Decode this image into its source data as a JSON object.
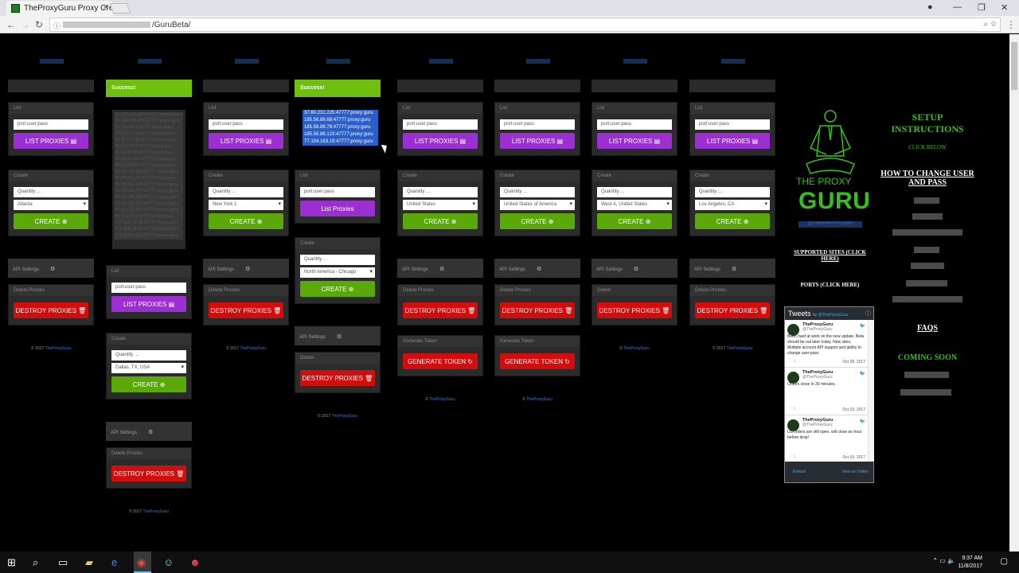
{
  "browser": {
    "tab_title": "TheProxyGuru Proxy Cre",
    "url_visible": "/GuruBeta/",
    "back": "←",
    "forward": "→",
    "reload": "↻"
  },
  "columns": [
    {
      "list_title": "List",
      "list_placeholder": "port:user:pass",
      "list_btn": "LIST PROXIES ▤",
      "create_title": "Create",
      "qty_placeholder": "Quantity ...",
      "region": "Atlanta",
      "create_btn": "CREATE ⊕",
      "api": "API Settings",
      "delete_title": "Delete Proxies",
      "destroy_btn": "DESTROY PROXIES 🗑",
      "footer_year": "© 2017",
      "footer_link": "TheProxyGuru"
    },
    {
      "success": "Success!",
      "proxies": [
        "50.187.134.184:47777:proxy:guru",
        "50.184.209.172:47777:proxy:guru",
        "50.118.58.9:47777:proxy:guru",
        "45.55.111.94:47777:proxy:guru",
        "45.55.71.245:47777:proxy:guru",
        "45.63.6.227:47777:proxy:guru",
        "45.63.85.90:47777:proxy:guru",
        "45.63.79.132:47777:proxy:guru",
        "45.63.90.217:47777:proxy:guru",
        "45.76.103.135:47777:proxy:guru",
        "45.76.151.74:47777:proxy:guru",
        "45.79.151.188:47777:proxy:guru",
        "45.79.156.207:47777:proxy:guru",
        "45.79.155.205:47777:proxy:guru",
        "45.79.156.214:47777:proxy:guru",
        "45.79.179.187:47777:proxy:guru",
        "45.76.100.8:47777:proxy:guru",
        "172.104.10.28:47777:proxy:guru",
        "172.104.14.59:47777:proxy:guru",
        "172.104.3.131:47777:proxy:guru"
      ],
      "list_title": "List",
      "list_placeholder": "port:user:pass",
      "list_btn": "LIST PROXIES ▤",
      "create_title": "Create",
      "qty_placeholder": "Quantity ...",
      "region": "Dallas, TX, USA",
      "create_btn": "CREATE ⊕",
      "api": "API Settings",
      "delete_title": "Delete Proxies",
      "destroy_btn": "DESTROY PROXIES 🗑",
      "footer_year": "© 2017",
      "footer_link": "TheProxyGuru"
    },
    {
      "list_title": "List",
      "list_placeholder": "port:user:pass",
      "list_btn": "LIST PROXIES ▤",
      "create_title": "Create",
      "qty_placeholder": "Quantity ...",
      "region": "New York 1",
      "create_btn": "CREATE ⊕",
      "api": "API Settings",
      "delete_title": "Delete Proxies",
      "destroy_btn": "DESTROY PROXIES 🗑",
      "footer_year": "© 2017",
      "footer_link": "TheProxyGuru"
    },
    {
      "success": "Success!",
      "proxies": [
        "37.60.231.225:47777:proxy:guru",
        "185.56.86.68:47777:proxy:guru",
        "185.56.86.78:47777:proxy:guru",
        "185.56.86.123:47777:proxy:guru",
        "77.104.163.19:47777:proxy:guru"
      ],
      "list_title": "List",
      "list_placeholder": "port:user:pass",
      "list_btn": "List Proxies",
      "create_title": "Create",
      "qty_placeholder": "Quantity ...",
      "region": "North America - Chicago",
      "create_btn": "CREATE ⊕",
      "api": "API Settings",
      "delete_title": "Delete",
      "destroy_btn": "DESTROY PROXIES 🗑",
      "footer_year": "© 2017",
      "footer_link": "TheProxyGuru"
    },
    {
      "list_title": "List",
      "list_placeholder": "port:user:pass",
      "list_btn": "LIST PROXIES ▤",
      "create_title": "Create",
      "qty_placeholder": "Quantity ...",
      "region": "United States",
      "create_btn": "CREATE ⊕",
      "api": "API Settings",
      "delete_title": "Delete Proxies",
      "destroy_btn": "DESTROY PROXIES 🗑",
      "token_title": "Generate Token",
      "token_btn": "GENERATE TOKEN ↻",
      "footer_year": "©",
      "footer_link": "TheProxyGuru"
    },
    {
      "list_title": "List",
      "list_placeholder": "port:user:pass",
      "list_btn": "LIST PROXIES ▤",
      "create_title": "Create",
      "qty_placeholder": "Quantity ...",
      "region": "United States of America",
      "create_btn": "CREATE ⊕",
      "api": "API Settings",
      "delete_title": "Delete Proxies",
      "destroy_btn": "DESTROY PROXIES 🗑",
      "token_title": "Generate Token",
      "token_btn": "GENERATE TOKEN ↻",
      "footer_year": "©",
      "footer_link": "TheProxyGuru"
    },
    {
      "list_title": "List",
      "list_placeholder": "port:user:pass",
      "list_btn": "LIST PROXIES ▤",
      "create_title": "Create",
      "qty_placeholder": "Quantity ...",
      "region": "West A, United States",
      "create_btn": "CREATE ⊕",
      "api": "API Settings",
      "delete_title": "Delete",
      "destroy_btn": "DESTROY PROXIES 🗑",
      "footer_year": "©",
      "footer_link": "TheProxyGuru"
    },
    {
      "list_title": "List",
      "list_placeholder": "port:user:pass",
      "list_btn": "LIST PROXIES ▤",
      "create_title": "Create",
      "qty_placeholder": "Quantity ...",
      "region": "Los Angeles, CA",
      "create_btn": "CREATE ⊕",
      "api": "API Settings",
      "delete_title": "Delete Proxies",
      "destroy_btn": "DESTROY PROXIES 🗑",
      "footer_year": "© 2017",
      "footer_link": "TheProxyGuru"
    }
  ],
  "sidebar": {
    "logo_line1": "THE PROXY",
    "logo_line2": "GURU",
    "handle": "@THEPROXYGURU",
    "supported": "SUPPORTED SITES (CLICK HERE)",
    "ports": "PORTS (CLICK HERE)",
    "setup": "SETUP INSTRUCTIONS",
    "click_below": "CLICK BELOW",
    "how_to": "HOW TO CHANGE USER AND PASS",
    "faqs": "FAQS",
    "coming_soon": "COMING SOON"
  },
  "twitter": {
    "title": "Tweets",
    "by": "by",
    "by_handle": "@TheProxyGuru",
    "embed": "Embed",
    "view": "View on Twitter",
    "tweets": [
      {
        "name": "TheProxyGuru",
        "handle": "@TheProxyGuru",
        "text": "Been hard at work on the new update. Beta should be out later today. New sites, Multiple account API support and ability to change user:pass",
        "date": "Oct 28, 2017"
      },
      {
        "name": "TheProxyGuru",
        "handle": "@TheProxyGuru",
        "text": "Orders close in 30 minutes.",
        "date": "Oct 19, 2017"
      },
      {
        "name": "TheProxyGuru",
        "handle": "@TheProxyGuru",
        "text": "US orders are still open. will close an hour before drop!",
        "date": "Oct 19, 2017"
      }
    ]
  },
  "taskbar": {
    "time": "9:37 AM",
    "date": "11/8/2017"
  }
}
